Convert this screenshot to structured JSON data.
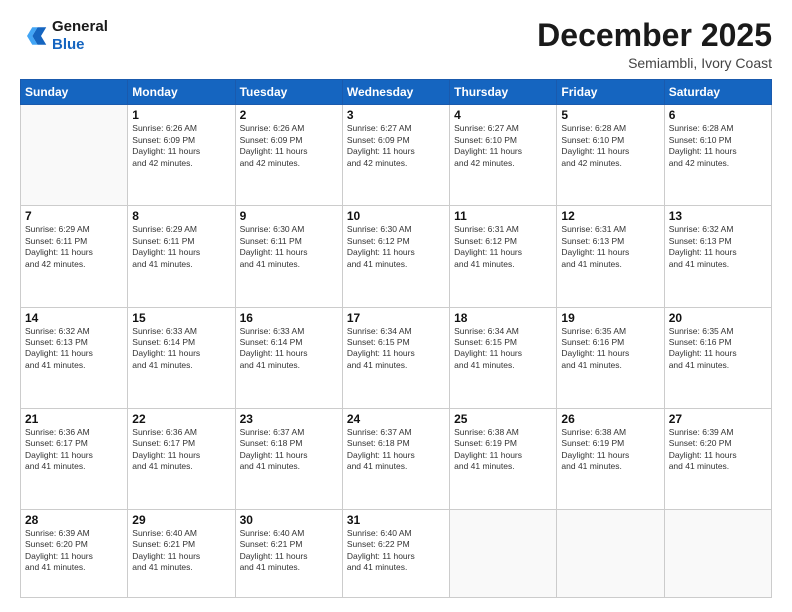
{
  "header": {
    "logo_general": "General",
    "logo_blue": "Blue",
    "month_title": "December 2025",
    "subtitle": "Semiambli, Ivory Coast"
  },
  "days_of_week": [
    "Sunday",
    "Monday",
    "Tuesday",
    "Wednesday",
    "Thursday",
    "Friday",
    "Saturday"
  ],
  "weeks": [
    [
      {
        "day": "",
        "info": ""
      },
      {
        "day": "1",
        "info": "Sunrise: 6:26 AM\nSunset: 6:09 PM\nDaylight: 11 hours\nand 42 minutes."
      },
      {
        "day": "2",
        "info": "Sunrise: 6:26 AM\nSunset: 6:09 PM\nDaylight: 11 hours\nand 42 minutes."
      },
      {
        "day": "3",
        "info": "Sunrise: 6:27 AM\nSunset: 6:09 PM\nDaylight: 11 hours\nand 42 minutes."
      },
      {
        "day": "4",
        "info": "Sunrise: 6:27 AM\nSunset: 6:10 PM\nDaylight: 11 hours\nand 42 minutes."
      },
      {
        "day": "5",
        "info": "Sunrise: 6:28 AM\nSunset: 6:10 PM\nDaylight: 11 hours\nand 42 minutes."
      },
      {
        "day": "6",
        "info": "Sunrise: 6:28 AM\nSunset: 6:10 PM\nDaylight: 11 hours\nand 42 minutes."
      }
    ],
    [
      {
        "day": "7",
        "info": "Sunrise: 6:29 AM\nSunset: 6:11 PM\nDaylight: 11 hours\nand 42 minutes."
      },
      {
        "day": "8",
        "info": "Sunrise: 6:29 AM\nSunset: 6:11 PM\nDaylight: 11 hours\nand 41 minutes."
      },
      {
        "day": "9",
        "info": "Sunrise: 6:30 AM\nSunset: 6:11 PM\nDaylight: 11 hours\nand 41 minutes."
      },
      {
        "day": "10",
        "info": "Sunrise: 6:30 AM\nSunset: 6:12 PM\nDaylight: 11 hours\nand 41 minutes."
      },
      {
        "day": "11",
        "info": "Sunrise: 6:31 AM\nSunset: 6:12 PM\nDaylight: 11 hours\nand 41 minutes."
      },
      {
        "day": "12",
        "info": "Sunrise: 6:31 AM\nSunset: 6:13 PM\nDaylight: 11 hours\nand 41 minutes."
      },
      {
        "day": "13",
        "info": "Sunrise: 6:32 AM\nSunset: 6:13 PM\nDaylight: 11 hours\nand 41 minutes."
      }
    ],
    [
      {
        "day": "14",
        "info": "Sunrise: 6:32 AM\nSunset: 6:13 PM\nDaylight: 11 hours\nand 41 minutes."
      },
      {
        "day": "15",
        "info": "Sunrise: 6:33 AM\nSunset: 6:14 PM\nDaylight: 11 hours\nand 41 minutes."
      },
      {
        "day": "16",
        "info": "Sunrise: 6:33 AM\nSunset: 6:14 PM\nDaylight: 11 hours\nand 41 minutes."
      },
      {
        "day": "17",
        "info": "Sunrise: 6:34 AM\nSunset: 6:15 PM\nDaylight: 11 hours\nand 41 minutes."
      },
      {
        "day": "18",
        "info": "Sunrise: 6:34 AM\nSunset: 6:15 PM\nDaylight: 11 hours\nand 41 minutes."
      },
      {
        "day": "19",
        "info": "Sunrise: 6:35 AM\nSunset: 6:16 PM\nDaylight: 11 hours\nand 41 minutes."
      },
      {
        "day": "20",
        "info": "Sunrise: 6:35 AM\nSunset: 6:16 PM\nDaylight: 11 hours\nand 41 minutes."
      }
    ],
    [
      {
        "day": "21",
        "info": "Sunrise: 6:36 AM\nSunset: 6:17 PM\nDaylight: 11 hours\nand 41 minutes."
      },
      {
        "day": "22",
        "info": "Sunrise: 6:36 AM\nSunset: 6:17 PM\nDaylight: 11 hours\nand 41 minutes."
      },
      {
        "day": "23",
        "info": "Sunrise: 6:37 AM\nSunset: 6:18 PM\nDaylight: 11 hours\nand 41 minutes."
      },
      {
        "day": "24",
        "info": "Sunrise: 6:37 AM\nSunset: 6:18 PM\nDaylight: 11 hours\nand 41 minutes."
      },
      {
        "day": "25",
        "info": "Sunrise: 6:38 AM\nSunset: 6:19 PM\nDaylight: 11 hours\nand 41 minutes."
      },
      {
        "day": "26",
        "info": "Sunrise: 6:38 AM\nSunset: 6:19 PM\nDaylight: 11 hours\nand 41 minutes."
      },
      {
        "day": "27",
        "info": "Sunrise: 6:39 AM\nSunset: 6:20 PM\nDaylight: 11 hours\nand 41 minutes."
      }
    ],
    [
      {
        "day": "28",
        "info": "Sunrise: 6:39 AM\nSunset: 6:20 PM\nDaylight: 11 hours\nand 41 minutes."
      },
      {
        "day": "29",
        "info": "Sunrise: 6:40 AM\nSunset: 6:21 PM\nDaylight: 11 hours\nand 41 minutes."
      },
      {
        "day": "30",
        "info": "Sunrise: 6:40 AM\nSunset: 6:21 PM\nDaylight: 11 hours\nand 41 minutes."
      },
      {
        "day": "31",
        "info": "Sunrise: 6:40 AM\nSunset: 6:22 PM\nDaylight: 11 hours\nand 41 minutes."
      },
      {
        "day": "",
        "info": ""
      },
      {
        "day": "",
        "info": ""
      },
      {
        "day": "",
        "info": ""
      }
    ]
  ]
}
